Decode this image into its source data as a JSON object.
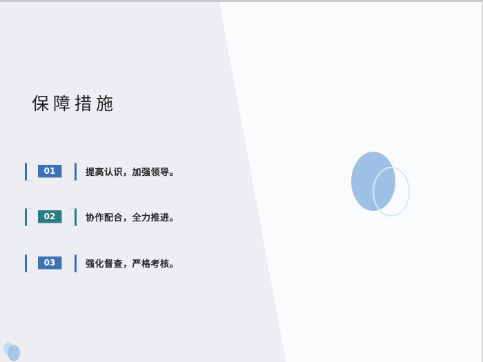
{
  "slide": {
    "title": "保障措施",
    "items": [
      {
        "number": "01",
        "text": "提高认识，加强领导。",
        "color": "#3f72b5"
      },
      {
        "number": "02",
        "text": "协作配合，全力推进。",
        "color": "#2b7a86"
      },
      {
        "number": "03",
        "text": "强化督查，严格考核。",
        "color": "#3f72b5"
      }
    ]
  },
  "colors": {
    "panel_gray": "#eceef2",
    "accent_blue": "#3f72b5",
    "accent_teal": "#2b7a86",
    "circle_blue": "#9dc0e4",
    "background": "#fafbfc"
  }
}
